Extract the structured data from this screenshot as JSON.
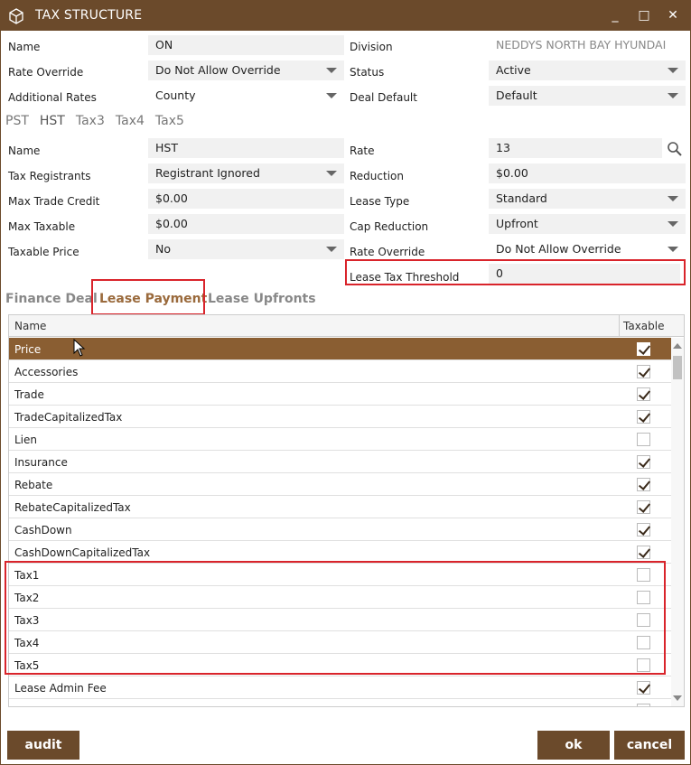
{
  "window": {
    "title": "TAX STRUCTURE",
    "minimize": "_",
    "maximize": "□",
    "close": "✕"
  },
  "top": {
    "name_label": "Name",
    "name_value": "ON",
    "division_label": "Division",
    "division_value": "NEDDYS NORTH BAY HYUNDAI",
    "rate_override_label": "Rate Override",
    "rate_override_value": "Do Not Allow Override",
    "status_label": "Status",
    "status_value": "Active",
    "additional_rates_label": "Additional Rates",
    "additional_rates_value": "County",
    "deal_default_label": "Deal Default",
    "deal_default_value": "Default"
  },
  "tax_tabs": [
    "PST",
    "HST",
    "Tax3",
    "Tax4",
    "Tax5"
  ],
  "tax": {
    "name_label": "Name",
    "name_value": "HST",
    "rate_label": "Rate",
    "rate_value": "13",
    "registrants_label": "Tax Registrants",
    "registrants_value": "Registrant Ignored",
    "reduction_label": "Reduction",
    "reduction_value": "$0.00",
    "max_trade_label": "Max Trade Credit",
    "max_trade_value": "$0.00",
    "lease_type_label": "Lease Type",
    "lease_type_value": "Standard",
    "max_taxable_label": "Max Taxable",
    "max_taxable_value": "$0.00",
    "cap_reduction_label": "Cap Reduction",
    "cap_reduction_value": "Upfront",
    "taxable_price_label": "Taxable Price",
    "taxable_price_value": "No",
    "rate_override_label": "Rate Override",
    "rate_override_value": "Do Not Allow Override",
    "lease_threshold_label": "Lease Tax Threshold",
    "lease_threshold_value": "0"
  },
  "section_tabs": [
    "Finance Deal",
    "Lease Payment",
    "Lease Upfronts"
  ],
  "grid": {
    "col_name": "Name",
    "col_taxable": "Taxable",
    "rows": [
      {
        "name": "Price",
        "taxable": true
      },
      {
        "name": "Accessories",
        "taxable": true
      },
      {
        "name": "Trade",
        "taxable": true
      },
      {
        "name": "TradeCapitalizedTax",
        "taxable": true
      },
      {
        "name": "Lien",
        "taxable": false
      },
      {
        "name": "Insurance",
        "taxable": true
      },
      {
        "name": "Rebate",
        "taxable": true
      },
      {
        "name": "RebateCapitalizedTax",
        "taxable": true
      },
      {
        "name": "CashDown",
        "taxable": true
      },
      {
        "name": "CashDownCapitalizedTax",
        "taxable": true
      },
      {
        "name": "Tax1",
        "taxable": false
      },
      {
        "name": "Tax2",
        "taxable": false
      },
      {
        "name": "Tax3",
        "taxable": false
      },
      {
        "name": "Tax4",
        "taxable": false
      },
      {
        "name": "Tax5",
        "taxable": false
      },
      {
        "name": "Lease Admin Fee",
        "taxable": true
      },
      {
        "name": "",
        "taxable": true
      }
    ]
  },
  "buttons": {
    "audit": "audit",
    "ok": "ok",
    "cancel": "cancel"
  },
  "colors": {
    "brand": "#6b4a2b",
    "selected_row": "#8a5e32",
    "highlight": "#d9242b"
  }
}
